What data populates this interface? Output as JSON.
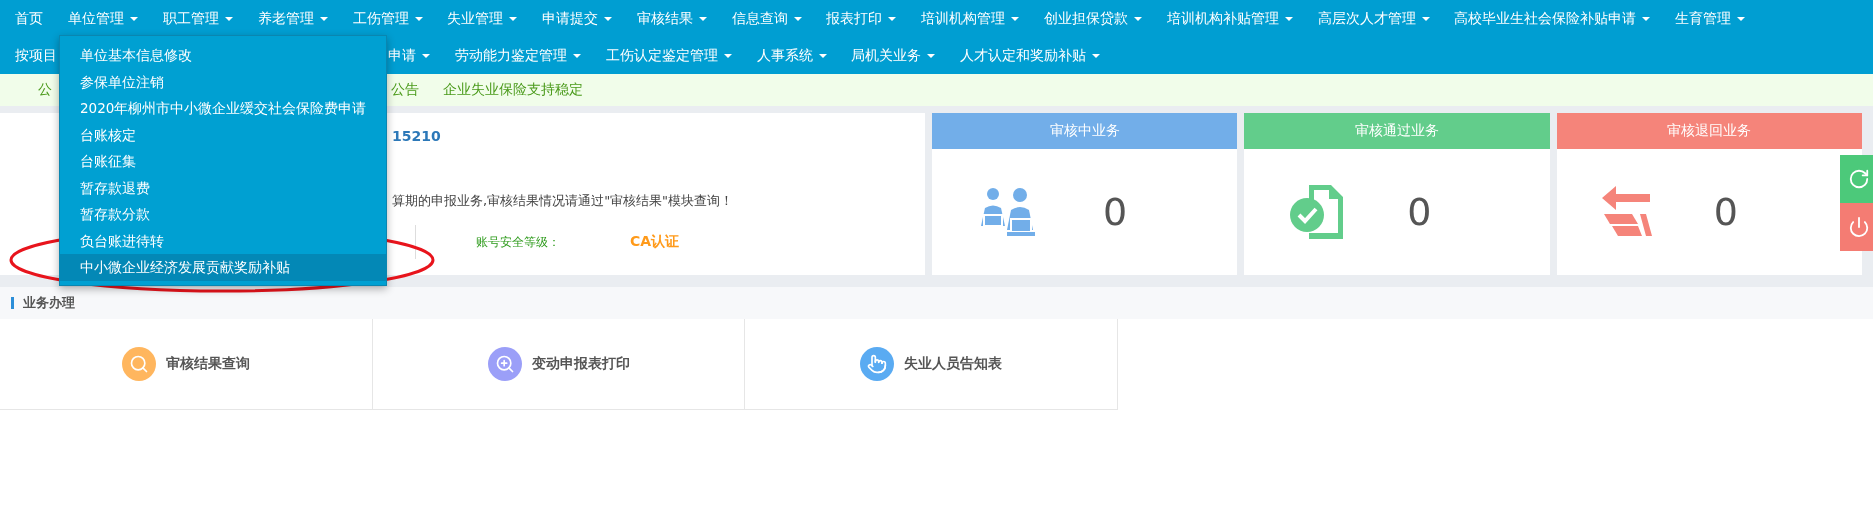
{
  "nav_rows": [
    [
      {
        "label": "首页",
        "caret": false
      },
      {
        "label": "单位管理",
        "caret": true
      },
      {
        "label": "职工管理",
        "caret": true
      },
      {
        "label": "养老管理",
        "caret": true
      },
      {
        "label": "工伤管理",
        "caret": true
      },
      {
        "label": "失业管理",
        "caret": true
      },
      {
        "label": "申请提交",
        "caret": true
      },
      {
        "label": "审核结果",
        "caret": true
      },
      {
        "label": "信息查询",
        "caret": true
      },
      {
        "label": "报表打印",
        "caret": true
      },
      {
        "label": "培训机构管理",
        "caret": true
      },
      {
        "label": "创业担保贷款",
        "caret": true
      },
      {
        "label": "培训机构补贴管理",
        "caret": true
      },
      {
        "label": "高层次人才管理",
        "caret": true
      },
      {
        "label": "高校毕业生社会保险补贴申请",
        "caret": true
      },
      {
        "label": "生育管理",
        "caret": true
      }
    ],
    [
      {
        "label": "按项目",
        "caret": false
      },
      {
        "label": "申请",
        "caret": true
      },
      {
        "label": "劳动能力鉴定管理",
        "caret": true
      },
      {
        "label": "工伤认定鉴定管理",
        "caret": true
      },
      {
        "label": "人事系统",
        "caret": true
      },
      {
        "label": "局机关业务",
        "caret": true
      },
      {
        "label": "人才认定和奖励补贴",
        "caret": true
      }
    ]
  ],
  "dropdown": {
    "items": [
      {
        "label": "单位基本信息修改",
        "selected": false
      },
      {
        "label": "参保单位注销",
        "selected": false
      },
      {
        "label": "2020年柳州市中小微企业缓交社会保险费申请",
        "selected": false
      },
      {
        "label": "台账核定",
        "selected": false
      },
      {
        "label": "台账征集",
        "selected": false
      },
      {
        "label": "暂存款退费",
        "selected": false
      },
      {
        "label": "暂存款分款",
        "selected": false
      },
      {
        "label": "负台账进待转",
        "selected": false
      },
      {
        "label": "中小微企业经济发展贡献奖励补贴",
        "selected": true
      }
    ]
  },
  "notices": [
    "公",
    "公告",
    "企业失业保险支持稳定"
  ],
  "account": {
    "id": "15210",
    "message": "算期的申报业务,审核结果情况请通过\"审核结果\"模块查询！",
    "security_label": "账号安全等级：",
    "security_value": "CA认证"
  },
  "stats": [
    {
      "title": "审核中业务",
      "count": "0",
      "color": "#72aee9",
      "kind": "people"
    },
    {
      "title": "审核通过业务",
      "count": "0",
      "color": "#62cd8b",
      "kind": "document"
    },
    {
      "title": "审核退回业务",
      "count": "0",
      "color": "#f5847a",
      "kind": "return"
    }
  ],
  "section": {
    "title": "业务办理"
  },
  "tiles": [
    {
      "label": "审核结果查询",
      "color": "#ffb65e",
      "kind": "search"
    },
    {
      "label": "变动申报表打印",
      "color": "#9b9ff8",
      "kind": "zoom"
    },
    {
      "label": "失业人员告知表",
      "color": "#5aabf2",
      "kind": "hand"
    }
  ]
}
